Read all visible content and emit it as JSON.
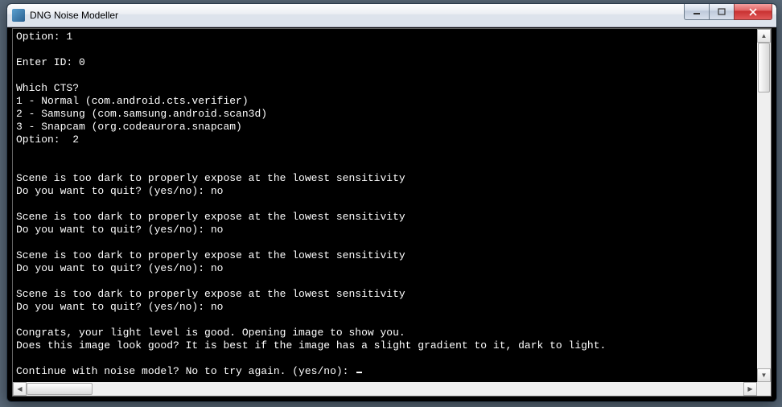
{
  "window": {
    "title": "DNG Noise Modeller"
  },
  "console": {
    "lines": [
      "Option: 1",
      "",
      "Enter ID: 0",
      "",
      "Which CTS?",
      "1 - Normal (com.android.cts.verifier)",
      "2 - Samsung (com.samsung.android.scan3d)",
      "3 - Snapcam (org.codeaurora.snapcam)",
      "Option:  2",
      "",
      "",
      "Scene is too dark to properly expose at the lowest sensitivity",
      "Do you want to quit? (yes/no): no",
      "",
      "Scene is too dark to properly expose at the lowest sensitivity",
      "Do you want to quit? (yes/no): no",
      "",
      "Scene is too dark to properly expose at the lowest sensitivity",
      "Do you want to quit? (yes/no): no",
      "",
      "Scene is too dark to properly expose at the lowest sensitivity",
      "Do you want to quit? (yes/no): no",
      "",
      "Congrats, your light level is good. Opening image to show you.",
      "Does this image look good? It is best if the image has a slight gradient to it, dark to light.",
      "",
      "Continue with noise model? No to try again. (yes/no): "
    ]
  },
  "icons": {
    "minimize": "—",
    "maximize": "▭",
    "close": "✕",
    "up": "▲",
    "down": "▼",
    "left": "◀",
    "right": "▶"
  }
}
